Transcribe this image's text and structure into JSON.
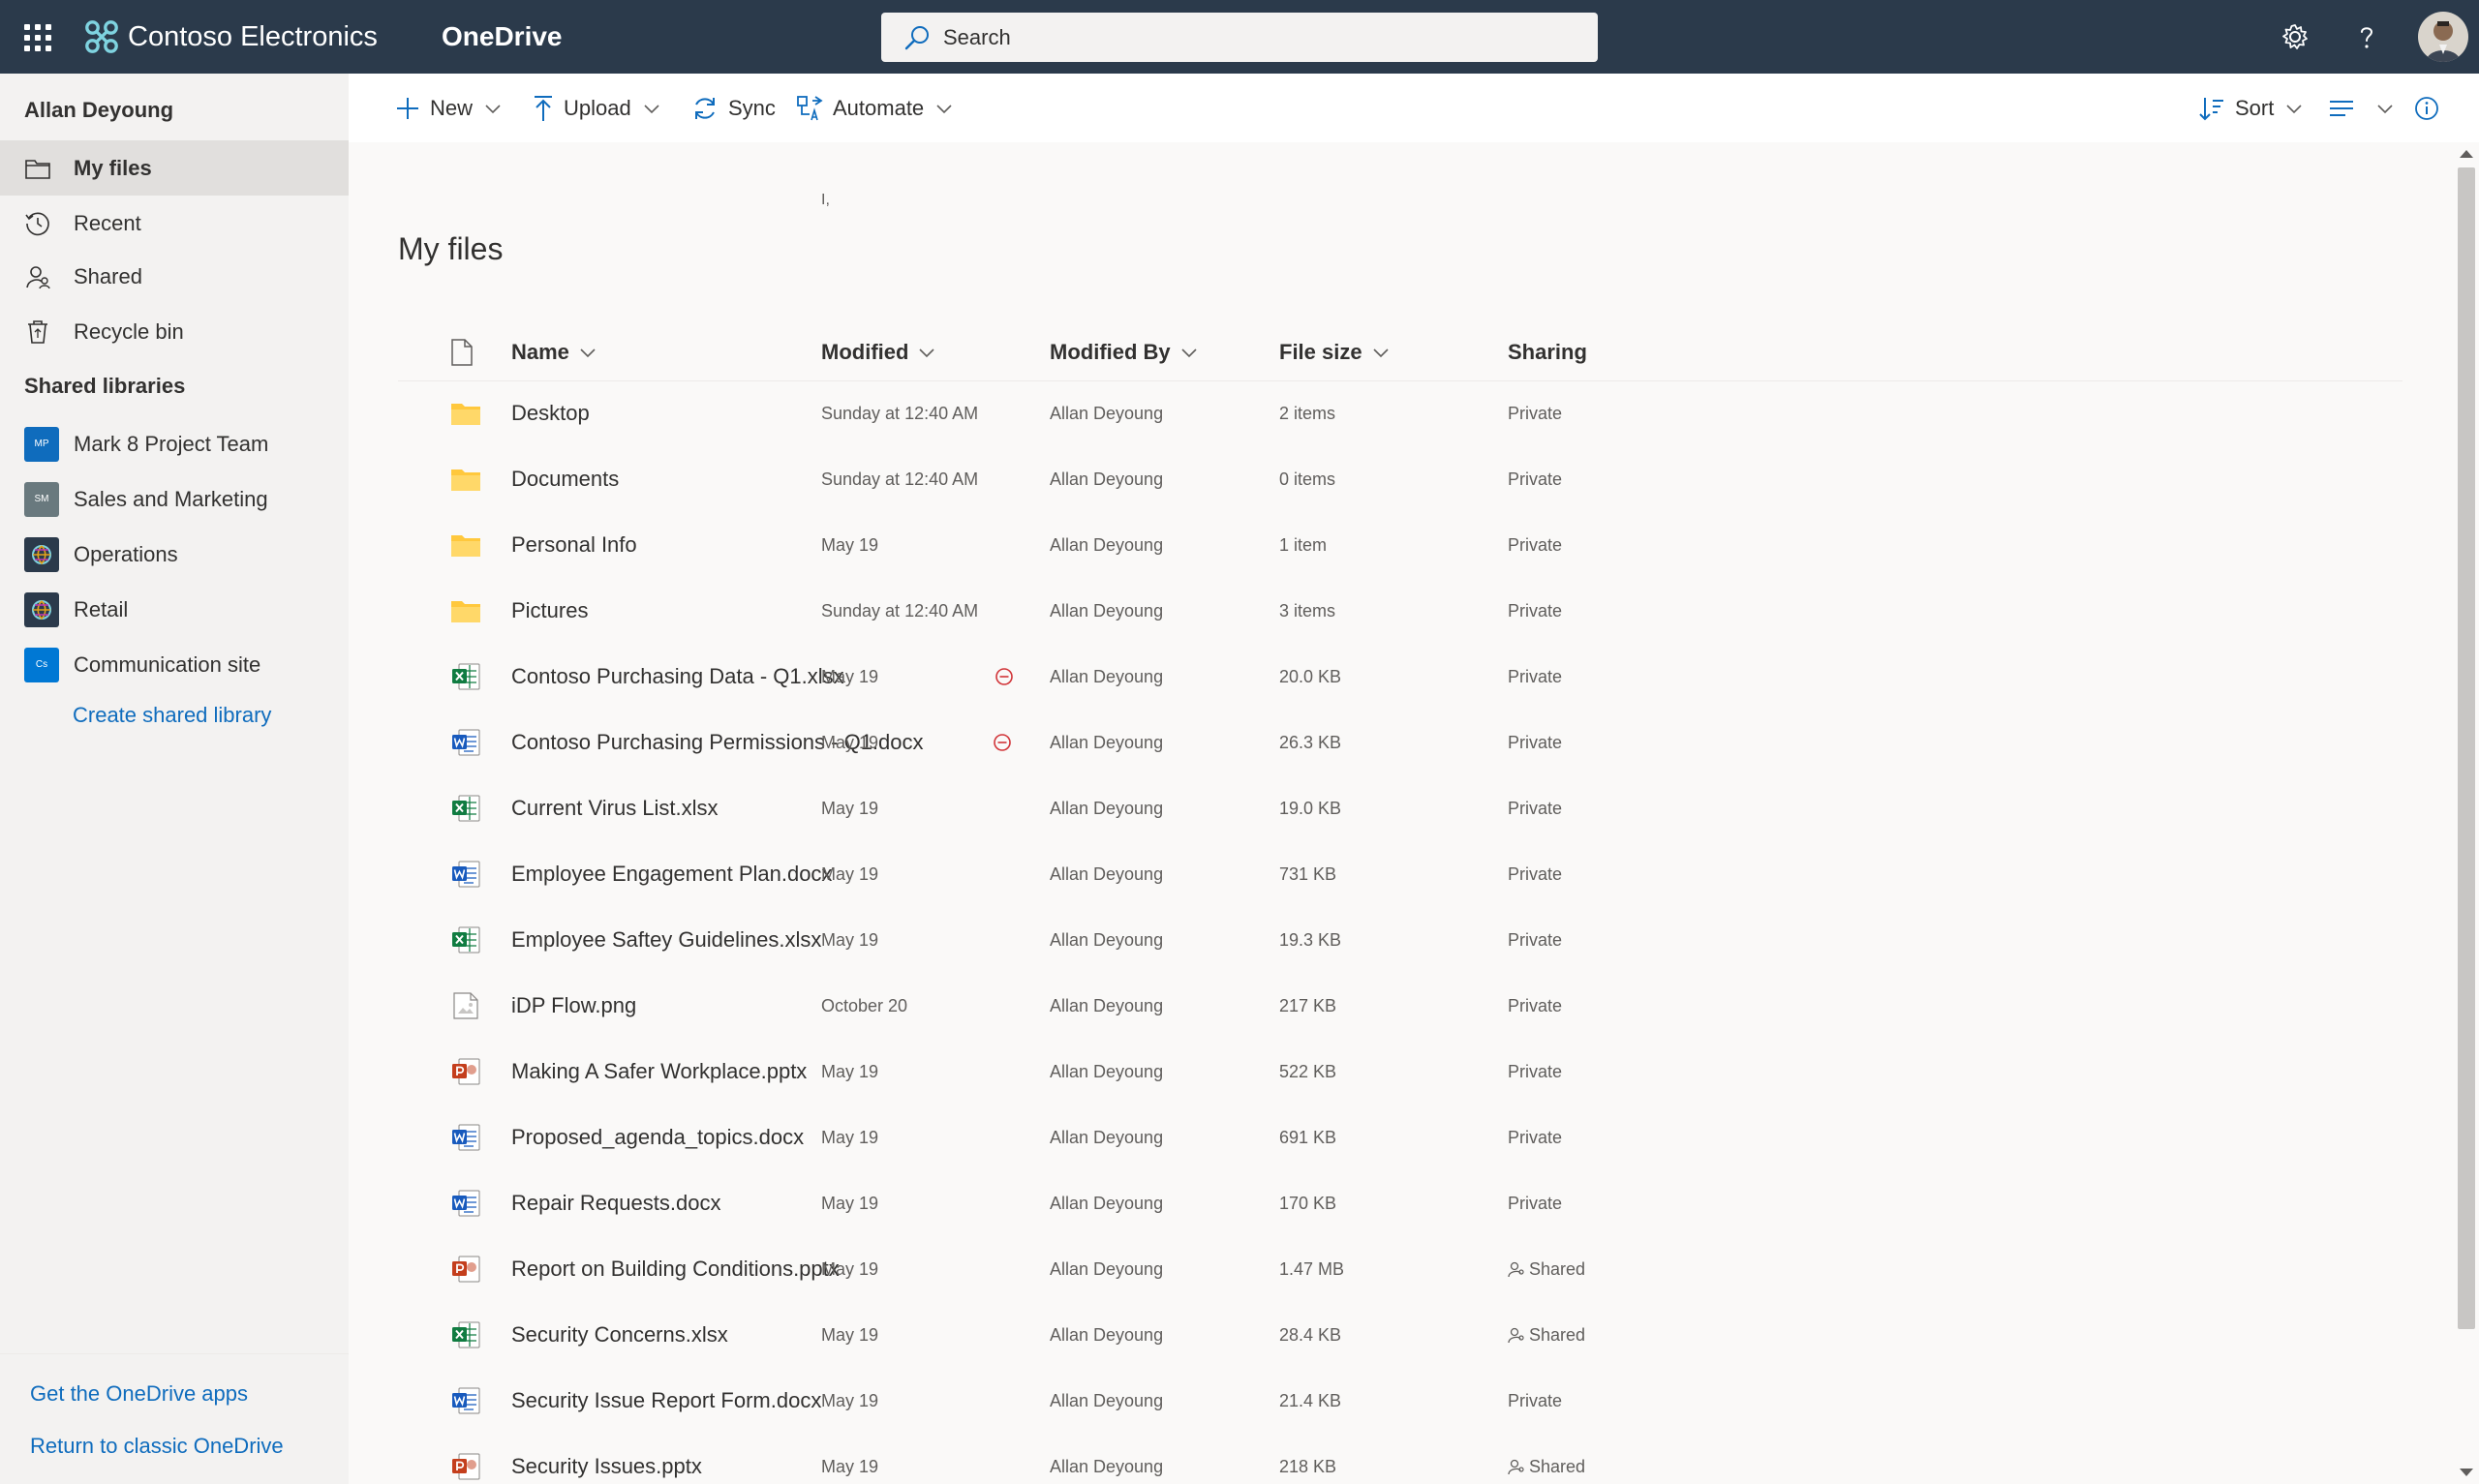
{
  "header": {
    "org_name": "Contoso Electronics",
    "app_name": "OneDrive",
    "search_placeholder": "Search"
  },
  "sidebar": {
    "user_name": "Allan Deyoung",
    "items": [
      {
        "label": "My files",
        "icon": "folder-icon",
        "selected": true
      },
      {
        "label": "Recent",
        "icon": "clock-icon"
      },
      {
        "label": "Shared",
        "icon": "people-icon"
      },
      {
        "label": "Recycle bin",
        "icon": "recycle-bin-icon"
      }
    ],
    "shared_libraries_title": "Shared libraries",
    "libraries": [
      {
        "label": "Mark 8 Project Team",
        "initials": "MP",
        "color": "#0f6cbd"
      },
      {
        "label": "Sales and Marketing",
        "initials": "SM",
        "color": "#69797e"
      },
      {
        "label": "Operations",
        "initials": "",
        "color": "#2b3a4b"
      },
      {
        "label": "Retail",
        "initials": "",
        "color": "#2b3a4b"
      },
      {
        "label": "Communication site",
        "initials": "Cs",
        "color": "#0078d4"
      }
    ],
    "create_library": "Create shared library",
    "footer_links": [
      "Get the OneDrive apps",
      "Return to classic OneDrive"
    ]
  },
  "commandbar": {
    "new": "New",
    "upload": "Upload",
    "sync": "Sync",
    "automate": "Automate",
    "sort": "Sort"
  },
  "main": {
    "caret": "I,",
    "title": "My files",
    "columns": {
      "name": "Name",
      "modified": "Modified",
      "modified_by": "Modified By",
      "file_size": "File size",
      "sharing": "Sharing"
    },
    "files": [
      {
        "name": "Desktop",
        "type": "folder",
        "modified": "Sunday at 12:40 AM",
        "by": "Allan Deyoung",
        "size": "2 items",
        "sharing": "Private"
      },
      {
        "name": "Documents",
        "type": "folder",
        "modified": "Sunday at 12:40 AM",
        "by": "Allan Deyoung",
        "size": "0 items",
        "sharing": "Private"
      },
      {
        "name": "Personal Info",
        "type": "folder",
        "modified": "May 19",
        "by": "Allan Deyoung",
        "size": "1 item",
        "sharing": "Private"
      },
      {
        "name": "Pictures",
        "type": "folder",
        "modified": "Sunday at 12:40 AM",
        "by": "Allan Deyoung",
        "size": "3 items",
        "sharing": "Private"
      },
      {
        "name": "Contoso Purchasing Data - Q1.xlsx",
        "type": "xlsx",
        "blocked": true,
        "modified": "May 19",
        "by": "Allan Deyoung",
        "size": "20.0 KB",
        "sharing": "Private"
      },
      {
        "name": "Contoso Purchasing Permissions - Q1.docx",
        "type": "docx",
        "blocked": true,
        "modified": "May 19",
        "by": "Allan Deyoung",
        "size": "26.3 KB",
        "sharing": "Private"
      },
      {
        "name": "Current Virus List.xlsx",
        "type": "xlsx",
        "modified": "May 19",
        "by": "Allan Deyoung",
        "size": "19.0 KB",
        "sharing": "Private"
      },
      {
        "name": "Employee Engagement Plan.docx",
        "type": "docx",
        "modified": "May 19",
        "by": "Allan Deyoung",
        "size": "731 KB",
        "sharing": "Private"
      },
      {
        "name": "Employee Saftey Guidelines.xlsx",
        "type": "xlsx",
        "modified": "May 19",
        "by": "Allan Deyoung",
        "size": "19.3 KB",
        "sharing": "Private"
      },
      {
        "name": "iDP Flow.png",
        "type": "png",
        "modified": "October 20",
        "by": "Allan Deyoung",
        "size": "217 KB",
        "sharing": "Private"
      },
      {
        "name": "Making A Safer Workplace.pptx",
        "type": "pptx",
        "modified": "May 19",
        "by": "Allan Deyoung",
        "size": "522 KB",
        "sharing": "Private"
      },
      {
        "name": "Proposed_agenda_topics.docx",
        "type": "docx",
        "modified": "May 19",
        "by": "Allan Deyoung",
        "size": "691 KB",
        "sharing": "Private"
      },
      {
        "name": "Repair Requests.docx",
        "type": "docx",
        "modified": "May 19",
        "by": "Allan Deyoung",
        "size": "170 KB",
        "sharing": "Private"
      },
      {
        "name": "Report on Building Conditions.pptx",
        "type": "pptx",
        "modified": "May 19",
        "by": "Allan Deyoung",
        "size": "1.47 MB",
        "sharing": "Shared"
      },
      {
        "name": "Security Concerns.xlsx",
        "type": "xlsx",
        "modified": "May 19",
        "by": "Allan Deyoung",
        "size": "28.4 KB",
        "sharing": "Shared"
      },
      {
        "name": "Security Issue Report Form.docx",
        "type": "docx",
        "modified": "May 19",
        "by": "Allan Deyoung",
        "size": "21.4 KB",
        "sharing": "Private"
      },
      {
        "name": "Security Issues.pptx",
        "type": "pptx",
        "modified": "May 19",
        "by": "Allan Deyoung",
        "size": "218 KB",
        "sharing": "Shared"
      }
    ]
  },
  "colors": {
    "suite_bar": "#2b3a4b",
    "link": "#0f6cbd",
    "folder": "#ffc83d",
    "excel": "#107c41",
    "word": "#185abd",
    "powerpoint": "#c43e1c",
    "blocked": "#d13438"
  }
}
